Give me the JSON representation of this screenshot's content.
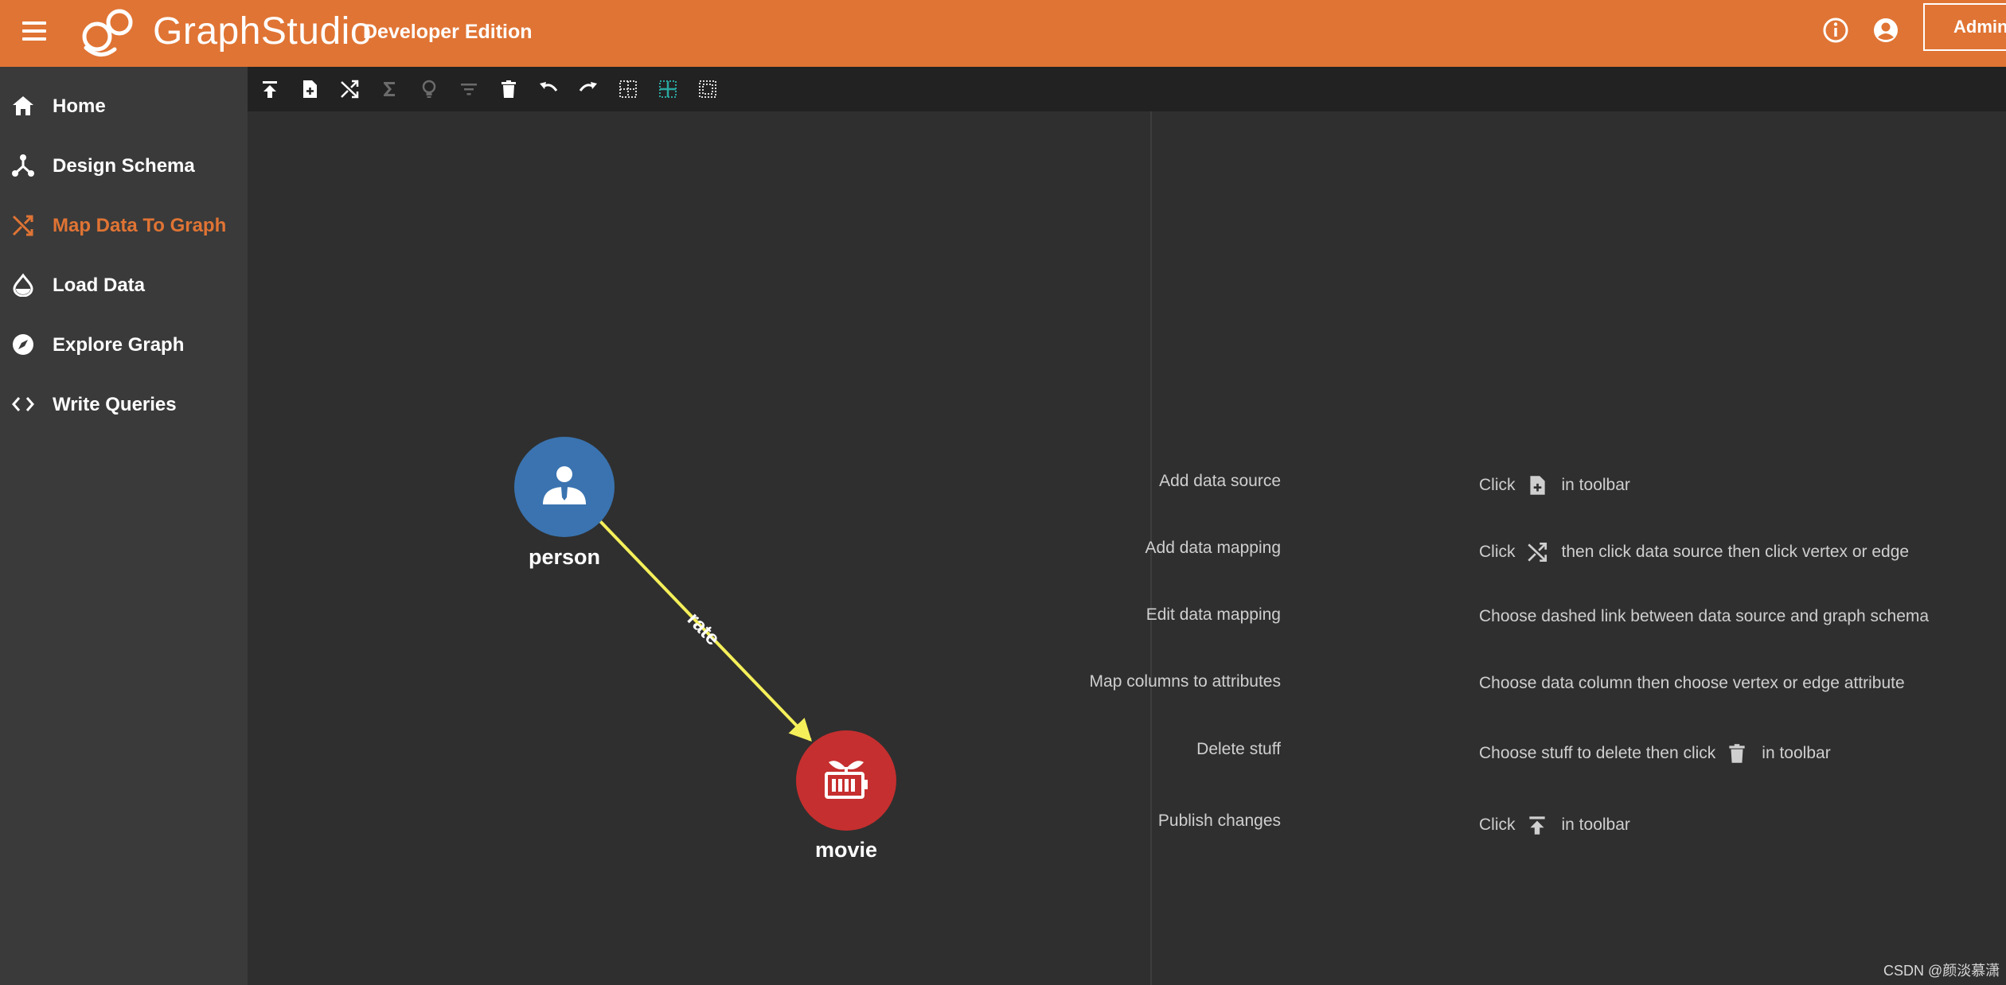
{
  "header": {
    "brand": "GraphStudio",
    "edition": "Developer Edition",
    "admin_label": "Admin"
  },
  "colors": {
    "header_bg": "#e07434",
    "accent": "#e07434",
    "sidebar_bg": "#3a3a3a",
    "toolbar_bg": "#222222",
    "canvas_bg": "#2f2f2f",
    "person_node": "#3a73b0",
    "movie_node": "#c62f2f",
    "edge": "#f5f05a"
  },
  "sidebar": {
    "items": [
      {
        "label": "Home",
        "icon": "home-icon"
      },
      {
        "label": "Design Schema",
        "icon": "schema-icon"
      },
      {
        "label": "Map Data To Graph",
        "icon": "shuffle-icon",
        "active": true
      },
      {
        "label": "Load Data",
        "icon": "drop-icon"
      },
      {
        "label": "Explore Graph",
        "icon": "compass-icon"
      },
      {
        "label": "Write Queries",
        "icon": "code-icon"
      }
    ]
  },
  "toolbar": {
    "tools": [
      "publish-icon",
      "add-file-icon",
      "shuffle-icon",
      "sigma-icon",
      "lightbulb-icon",
      "filter-icon",
      "trash-icon",
      "undo-icon",
      "redo-icon",
      "grid-select-icon",
      "grid-highlight-icon",
      "grid-dashed-icon"
    ]
  },
  "graph": {
    "nodes": [
      {
        "id": "person",
        "label": "person",
        "icon": "person-icon"
      },
      {
        "id": "movie",
        "label": "movie",
        "icon": "movie-icon"
      }
    ],
    "edges": [
      {
        "from": "person",
        "to": "movie",
        "label": "rate"
      }
    ]
  },
  "help": {
    "rows": [
      {
        "label": "Add data source",
        "before": "Click",
        "icon": "add-file-icon",
        "after": "in toolbar"
      },
      {
        "label": "Add data mapping",
        "before": "Click",
        "icon": "shuffle-icon",
        "after": "then click data source then click vertex or edge"
      },
      {
        "label": "Edit data mapping",
        "before": "Choose dashed link between data source and graph schema",
        "icon": "",
        "after": ""
      },
      {
        "label": "Map columns to attributes",
        "before": "Choose data column then choose vertex or edge attribute",
        "icon": "",
        "after": ""
      },
      {
        "label": "Delete stuff",
        "before": "Choose stuff to delete then click",
        "icon": "trash-icon",
        "after": "in toolbar"
      },
      {
        "label": "Publish changes",
        "before": "Click",
        "icon": "publish-icon",
        "after": "in toolbar"
      }
    ]
  },
  "watermark": "CSDN @颜淡慕潇"
}
